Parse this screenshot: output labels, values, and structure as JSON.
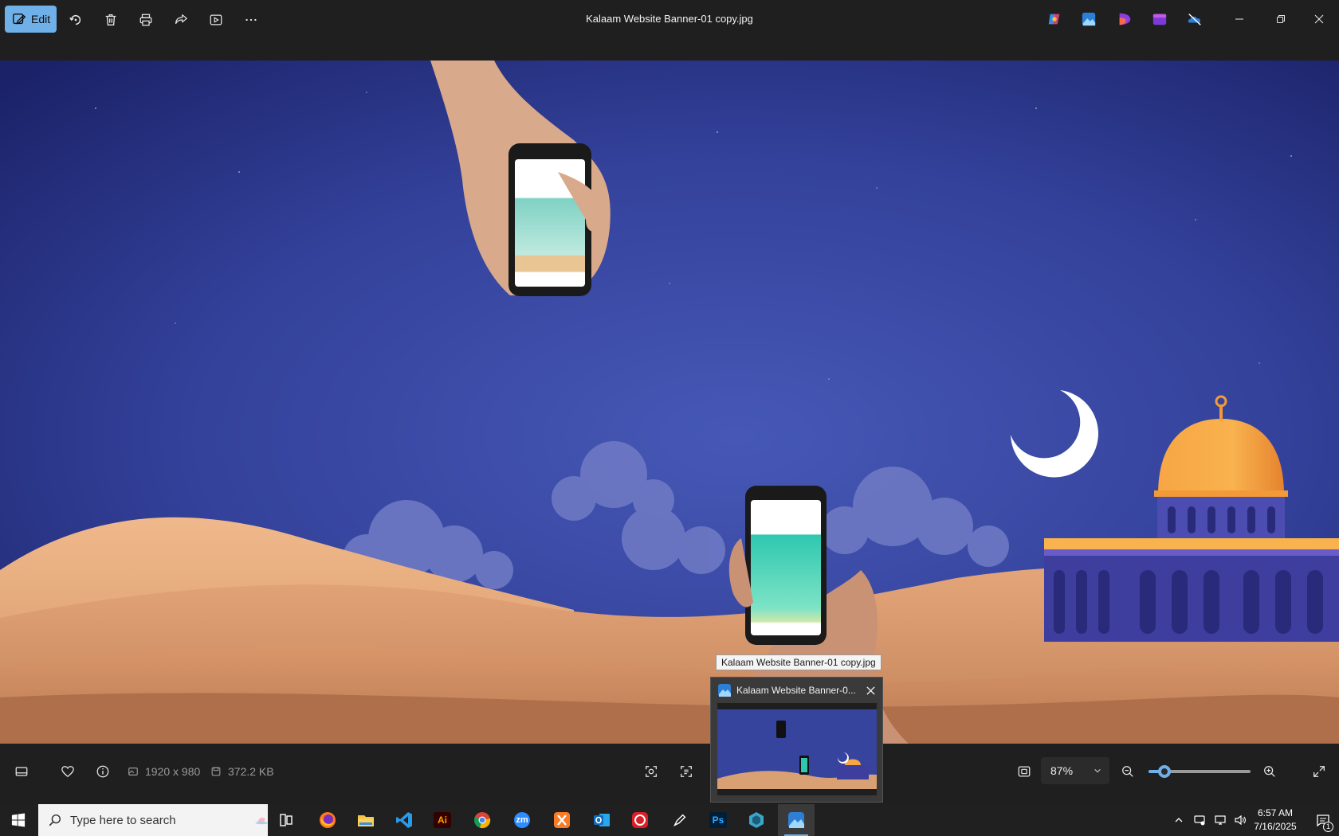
{
  "toolbar": {
    "edit_label": "Edit",
    "title": "Kalaam Website Banner-01 copy.jpg"
  },
  "image": {
    "dimensions": "1920 x 980",
    "file_size": "372.2 KB"
  },
  "zoom": {
    "level": "87%",
    "slider_fraction": 0.16
  },
  "tooltip": {
    "text": "Kalaam Website Banner-01 copy.jpg"
  },
  "thumbnail": {
    "title": "Kalaam Website Banner-0..."
  },
  "taskbar": {
    "search_placeholder": "Type here to search",
    "apps": [
      "task-view",
      "firefox",
      "file-explorer",
      "vscode",
      "illustrator",
      "chrome",
      "zoom",
      "xampp",
      "outlook",
      "creative-cloud",
      "pen-tool",
      "photoshop",
      "copilot-app",
      "photos"
    ],
    "illustrator_label": "Ai",
    "zoom_label": "zm",
    "photoshop_label": "Ps"
  },
  "clock": {
    "time": "6:57 AM",
    "date": "7/16/2025"
  },
  "notifications": {
    "count": "1"
  },
  "colors": {
    "accent": "#6fb0e8",
    "sky_top": "#1c2470",
    "sky_mid": "#3b4fa8",
    "sand": "#d9a173"
  }
}
